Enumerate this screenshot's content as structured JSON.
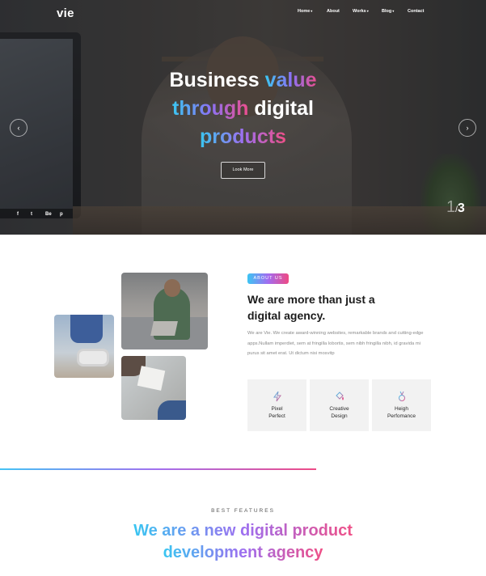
{
  "header": {
    "logo": "vie",
    "nav": [
      {
        "label": "Home",
        "caret": true
      },
      {
        "label": "About",
        "caret": false
      },
      {
        "label": "Works",
        "caret": true
      },
      {
        "label": "Blog",
        "caret": true
      },
      {
        "label": "Contact",
        "caret": false
      }
    ]
  },
  "hero": {
    "line1_white": "Business",
    "line1_grad": "value",
    "line2_grad": "through",
    "line2_white": "digital",
    "line3_grad": "products",
    "button": "Look More",
    "prev_icon": "chevron-left-icon",
    "next_icon": "chevron-right-icon",
    "social": [
      "f",
      "t",
      "Be",
      "p"
    ],
    "slide_current": "1",
    "slide_sep": "/",
    "slide_total": "3"
  },
  "about": {
    "badge": "ABOUT US",
    "title": "We are more than just a digital agency.",
    "text": "We are Vie. We create award-winning websites, remarkable brands and cutting-edge apps.Nullam imperdiet, sem at fringilla lobortis, sem nibh fringilla nibh, id gravida mi purus sit amet erat. Ut dictum nisi mosvitp",
    "features": [
      {
        "icon": "lightning-icon",
        "label": "Pixel\nPerfect"
      },
      {
        "icon": "paint-bucket-icon",
        "label": "Creative\nDesign"
      },
      {
        "icon": "medal-icon",
        "label": "Heigh\nPerfomance"
      }
    ]
  },
  "features_section": {
    "eyebrow": "BEST FEATURES",
    "title_line1": "We are a new digital product",
    "title_line2": "development agency"
  },
  "colors": {
    "gradient_start": "#3bc6f2",
    "gradient_mid": "#9d6ff0",
    "gradient_end": "#ef4f86"
  }
}
